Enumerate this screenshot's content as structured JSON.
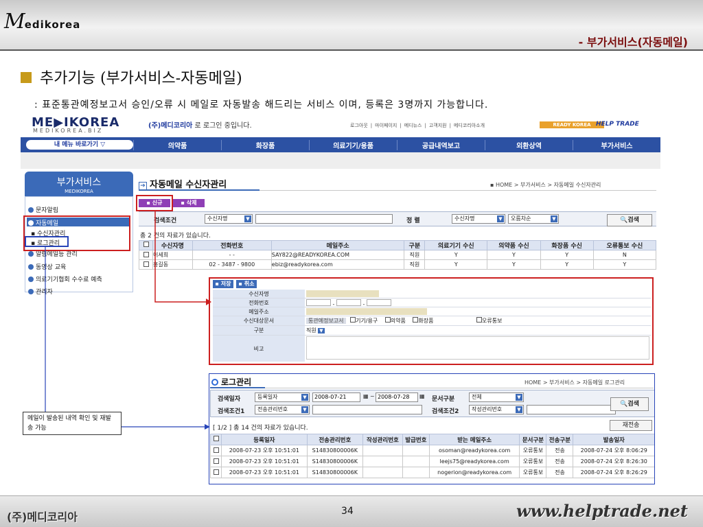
{
  "slide": {
    "logo_mark": "M",
    "logo_text": "edikorea",
    "subtitle": "- 부가서비스(자동메일)",
    "title": "추가기능 (부가서비스-자동메일)",
    "description": ": 표준통관예정보고서 승인/오류 시 메일로 자동발송 해드리는 서비스 이며, 등록은 3명까지 가능합니다.",
    "note": "메일이 발송된 내역 확인 및 재발송 가능",
    "footer_left": "(주)메디코리아",
    "page_number": "34",
    "footer_right": "www.helptrade.net"
  },
  "site": {
    "logo": "ME▶IKOREA",
    "logo_sub": "MEDIKOREA.BIZ",
    "login_company": "(주)메디코리아",
    "login_msg": " 로 로그인 중입니다.",
    "util_links": [
      "로그아웃",
      "마이페이지",
      "메디뉴스",
      "고객지원",
      "메디코리아소개"
    ],
    "ready_badge": "READY KOREA",
    "helptrade": "HELP TRADE",
    "my_menu": "내 메뉴 바로가기 ▽",
    "nav": [
      "의약품",
      "화장품",
      "의료기기/용품",
      "공급내역보고",
      "외환상역",
      "부가서비스"
    ]
  },
  "sidebar": {
    "title": "부가서비스",
    "subtitle": "MEDIKOREA",
    "items": [
      "문자알림",
      "자동메일",
      "수신자관리",
      "로그관리",
      "알림메일등 관리",
      "동영상 교육",
      "의료기기협회 수수료 예측",
      "관리자"
    ]
  },
  "content": {
    "title": "자동메일 수신자관리",
    "breadcrumb": "▪ HOME > 부가서비스 > 자동메일 수신자관리",
    "btn_new": "▪ 신규",
    "btn_delete": "▪ 삭제",
    "search_label": "검색조건",
    "search_select": "수신자명",
    "sort_label": "정 렬",
    "sort_select1": "수신자명",
    "sort_select2": "오름차순",
    "search_btn": "검색",
    "count": "총 2 건의 자료가 있습니다.",
    "table_headers": [
      "수신자명",
      "전화번호",
      "메일주소",
      "구분",
      "의료기기 수신",
      "의약품 수신",
      "화장품 수신",
      "오류통보 수신"
    ],
    "table_rows": [
      [
        "이세희",
        "- -",
        "SAY822@READYKOREA.COM",
        "직원",
        "Y",
        "Y",
        "Y",
        "N"
      ],
      [
        "홍길동",
        "02 - 3487 - 9800",
        "ebiz@readykorea.com",
        "직원",
        "Y",
        "Y",
        "Y",
        "Y"
      ]
    ]
  },
  "form": {
    "btn_save": "▪ 저장",
    "btn_cancel": "▪ 취소",
    "labels": [
      "수신자명",
      "전화번호",
      "메일주소",
      "수신대상문서",
      "구분",
      "비고"
    ],
    "doc_type": "통관예정보고서",
    "doc_options": [
      "기기/용구",
      "의약품",
      "화장품"
    ],
    "error_notice": "오류통보",
    "phone_sep": "-",
    "category_value": "직원"
  },
  "log": {
    "title": "로그관리",
    "breadcrumb": "HOME > 부가서비스 > 자동메일 로그관리",
    "date_label": "검색일자",
    "date_select": "등록일자",
    "date_from": "2008-07-21",
    "date_sep": "~",
    "date_to": "2008-07-28",
    "doc_label": "문서구분",
    "doc_select": "전체",
    "cond1_label": "검색조건1",
    "cond1_select": "전송관리번호",
    "cond2_label": "검색조건2",
    "cond2_select": "작성관리번호",
    "search_btn": "검색",
    "count": "[ 1/2 ]    총 14 건의 자료가 있습니다.",
    "resend_btn": "재전송",
    "table_headers": [
      "등록일자",
      "전송관리번호",
      "작성관리번호",
      "발급번호",
      "받는 메일주소",
      "문서구분",
      "전송구분",
      "발송일자"
    ],
    "table_rows": [
      [
        "2008-07-23 오후 10:51:01",
        "S14830800006K",
        "",
        "",
        "osoman@readykorea.com",
        "오류통보",
        "전송",
        "2008-07-24 오후 8:06:29"
      ],
      [
        "2008-07-23 오후 10:51:01",
        "S14830800006K",
        "",
        "",
        "leejs75@readykorea.com",
        "오류통보",
        "전송",
        "2008-07-24 오후 8:26:30"
      ],
      [
        "2008-07-23 오후 10:51:01",
        "S14830800006K",
        "",
        "",
        "nogerion@readykorea.com",
        "오류통보",
        "전송",
        "2008-07-24 오후 8:26:29"
      ]
    ]
  },
  "colors": {
    "accent": "#3b6ab8",
    "annotation_red": "#cc1f1f",
    "annotation_blue": "#2744b8",
    "button_purple": "#8f3fb6"
  }
}
